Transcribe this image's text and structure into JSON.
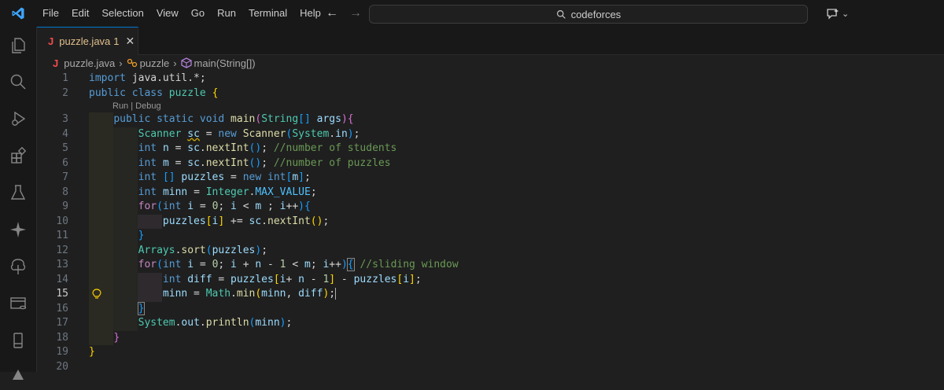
{
  "menu": [
    "File",
    "Edit",
    "Selection",
    "View",
    "Go",
    "Run",
    "Terminal",
    "Help"
  ],
  "search": {
    "text": "codeforces"
  },
  "tab": {
    "icon_letter": "J",
    "name": "puzzle.java",
    "problem_count": "1",
    "close": "✕"
  },
  "breadcrumb": {
    "file_icon": "J",
    "file": "puzzle.java",
    "class": "puzzle",
    "method": "main(String[])"
  },
  "codelens": "Run | Debug",
  "active_line": 15,
  "line_numbers": [
    "1",
    "2",
    "3",
    "4",
    "5",
    "6",
    "7",
    "8",
    "9",
    "10",
    "11",
    "12",
    "13",
    "14",
    "15",
    "16",
    "17",
    "18",
    "19",
    "20"
  ],
  "code": [
    [
      [
        "kw",
        "import"
      ],
      [
        "pl",
        " java.util.*;"
      ]
    ],
    [
      [
        "kw",
        "public"
      ],
      [
        "pl",
        " "
      ],
      [
        "kw",
        "class"
      ],
      [
        "pl",
        " "
      ],
      [
        "ty",
        "puzzle"
      ],
      [
        "pl",
        " "
      ],
      [
        "b1",
        "{"
      ]
    ],
    [
      [
        "pl",
        "    "
      ],
      [
        "kw",
        "public"
      ],
      [
        "pl",
        " "
      ],
      [
        "kw",
        "static"
      ],
      [
        "pl",
        " "
      ],
      [
        "kw",
        "void"
      ],
      [
        "pl",
        " "
      ],
      [
        "fn",
        "main"
      ],
      [
        "b2",
        "("
      ],
      [
        "ty",
        "String"
      ],
      [
        "b3",
        "[]"
      ],
      [
        "pl",
        " "
      ],
      [
        "var",
        "args"
      ],
      [
        "b2",
        ")"
      ],
      [
        "b2",
        "{"
      ]
    ],
    [
      [
        "pl",
        "        "
      ],
      [
        "ty",
        "Scanner"
      ],
      [
        "pl",
        " "
      ],
      [
        "varsq",
        "sc"
      ],
      [
        "pl",
        " = "
      ],
      [
        "kw",
        "new"
      ],
      [
        "pl",
        " "
      ],
      [
        "fn",
        "Scanner"
      ],
      [
        "b3",
        "("
      ],
      [
        "ty",
        "System"
      ],
      [
        "pl",
        "."
      ],
      [
        "var",
        "in"
      ],
      [
        "b3",
        ")"
      ],
      [
        "pl",
        ";"
      ]
    ],
    [
      [
        "pl",
        "        "
      ],
      [
        "kw",
        "int"
      ],
      [
        "pl",
        " "
      ],
      [
        "var",
        "n"
      ],
      [
        "pl",
        " = "
      ],
      [
        "var",
        "sc"
      ],
      [
        "pl",
        "."
      ],
      [
        "fn",
        "nextInt"
      ],
      [
        "b3",
        "()"
      ],
      [
        "pl",
        "; "
      ],
      [
        "cm",
        "//number of students"
      ]
    ],
    [
      [
        "pl",
        "        "
      ],
      [
        "kw",
        "int"
      ],
      [
        "pl",
        " "
      ],
      [
        "var",
        "m"
      ],
      [
        "pl",
        " = "
      ],
      [
        "var",
        "sc"
      ],
      [
        "pl",
        "."
      ],
      [
        "fn",
        "nextInt"
      ],
      [
        "b3",
        "()"
      ],
      [
        "pl",
        "; "
      ],
      [
        "cm",
        "//number of puzzles"
      ]
    ],
    [
      [
        "pl",
        "        "
      ],
      [
        "kw",
        "int"
      ],
      [
        "pl",
        " "
      ],
      [
        "b3",
        "[]"
      ],
      [
        "pl",
        " "
      ],
      [
        "var",
        "puzzles"
      ],
      [
        "pl",
        " = "
      ],
      [
        "kw",
        "new"
      ],
      [
        "pl",
        " "
      ],
      [
        "kw",
        "int"
      ],
      [
        "b3",
        "["
      ],
      [
        "var",
        "m"
      ],
      [
        "b3",
        "]"
      ],
      [
        "pl",
        ";"
      ]
    ],
    [
      [
        "pl",
        "        "
      ],
      [
        "kw",
        "int"
      ],
      [
        "pl",
        " "
      ],
      [
        "var",
        "minn"
      ],
      [
        "pl",
        " = "
      ],
      [
        "ty",
        "Integer"
      ],
      [
        "pl",
        "."
      ],
      [
        "const",
        "MAX_VALUE"
      ],
      [
        "pl",
        ";"
      ]
    ],
    [
      [
        "pl",
        "        "
      ],
      [
        "ctl",
        "for"
      ],
      [
        "b3",
        "("
      ],
      [
        "kw",
        "int"
      ],
      [
        "pl",
        " "
      ],
      [
        "var",
        "i"
      ],
      [
        "pl",
        " = "
      ],
      [
        "num",
        "0"
      ],
      [
        "pl",
        "; "
      ],
      [
        "var",
        "i"
      ],
      [
        "pl",
        " < "
      ],
      [
        "var",
        "m"
      ],
      [
        "pl",
        " ; "
      ],
      [
        "var",
        "i"
      ],
      [
        "pl",
        "++"
      ],
      [
        "b3",
        ")"
      ],
      [
        "b3",
        "{"
      ]
    ],
    [
      [
        "pl",
        "            "
      ],
      [
        "var",
        "puzzles"
      ],
      [
        "b1",
        "["
      ],
      [
        "var",
        "i"
      ],
      [
        "b1",
        "]"
      ],
      [
        "pl",
        " += "
      ],
      [
        "var",
        "sc"
      ],
      [
        "pl",
        "."
      ],
      [
        "fn",
        "nextInt"
      ],
      [
        "b1",
        "()"
      ],
      [
        "pl",
        ";"
      ]
    ],
    [
      [
        "pl",
        "        "
      ],
      [
        "b3",
        "}"
      ]
    ],
    [
      [
        "pl",
        "        "
      ],
      [
        "ty",
        "Arrays"
      ],
      [
        "pl",
        "."
      ],
      [
        "fn",
        "sort"
      ],
      [
        "b3",
        "("
      ],
      [
        "var",
        "puzzles"
      ],
      [
        "b3",
        ")"
      ],
      [
        "pl",
        ";"
      ]
    ],
    [
      [
        "pl",
        "        "
      ],
      [
        "ctl",
        "for"
      ],
      [
        "b3",
        "("
      ],
      [
        "kw",
        "int"
      ],
      [
        "pl",
        " "
      ],
      [
        "var",
        "i"
      ],
      [
        "pl",
        " = "
      ],
      [
        "num",
        "0"
      ],
      [
        "pl",
        "; "
      ],
      [
        "var",
        "i"
      ],
      [
        "pl",
        " + "
      ],
      [
        "var",
        "n"
      ],
      [
        "pl",
        " - "
      ],
      [
        "num",
        "1"
      ],
      [
        "pl",
        " < "
      ],
      [
        "var",
        "m"
      ],
      [
        "pl",
        "; "
      ],
      [
        "var",
        "i"
      ],
      [
        "pl",
        "++"
      ],
      [
        "b3",
        ")"
      ],
      [
        "box",
        "{"
      ],
      [
        "pl",
        " "
      ],
      [
        "cm",
        "//sliding window"
      ]
    ],
    [
      [
        "pl",
        "            "
      ],
      [
        "kw",
        "int"
      ],
      [
        "pl",
        " "
      ],
      [
        "var",
        "diff"
      ],
      [
        "pl",
        " = "
      ],
      [
        "var",
        "puzzles"
      ],
      [
        "b1",
        "["
      ],
      [
        "var",
        "i"
      ],
      [
        "pl",
        "+ "
      ],
      [
        "var",
        "n"
      ],
      [
        "pl",
        " - "
      ],
      [
        "num",
        "1"
      ],
      [
        "b1",
        "]"
      ],
      [
        "pl",
        " - "
      ],
      [
        "var",
        "puzzles"
      ],
      [
        "b1",
        "["
      ],
      [
        "var",
        "i"
      ],
      [
        "b1",
        "]"
      ],
      [
        "pl",
        ";"
      ]
    ],
    [
      [
        "pl",
        "            "
      ],
      [
        "var",
        "minn"
      ],
      [
        "pl",
        " = "
      ],
      [
        "ty",
        "Math"
      ],
      [
        "pl",
        "."
      ],
      [
        "fn",
        "min"
      ],
      [
        "b1",
        "("
      ],
      [
        "var",
        "minn"
      ],
      [
        "pl",
        ", "
      ],
      [
        "var",
        "diff"
      ],
      [
        "b1",
        ")"
      ],
      [
        "pl",
        ";"
      ],
      [
        "cursor",
        ""
      ]
    ],
    [
      [
        "pl",
        "        "
      ],
      [
        "box",
        "}"
      ]
    ],
    [
      [
        "pl",
        "        "
      ],
      [
        "ty",
        "System"
      ],
      [
        "pl",
        "."
      ],
      [
        "var",
        "out"
      ],
      [
        "pl",
        "."
      ],
      [
        "fn",
        "println"
      ],
      [
        "b3",
        "("
      ],
      [
        "var",
        "minn"
      ],
      [
        "b3",
        ")"
      ],
      [
        "pl",
        ";"
      ]
    ],
    [
      [
        "pl",
        "    "
      ],
      [
        "b2",
        "}"
      ]
    ],
    [
      [
        "b1",
        "}"
      ]
    ],
    []
  ]
}
